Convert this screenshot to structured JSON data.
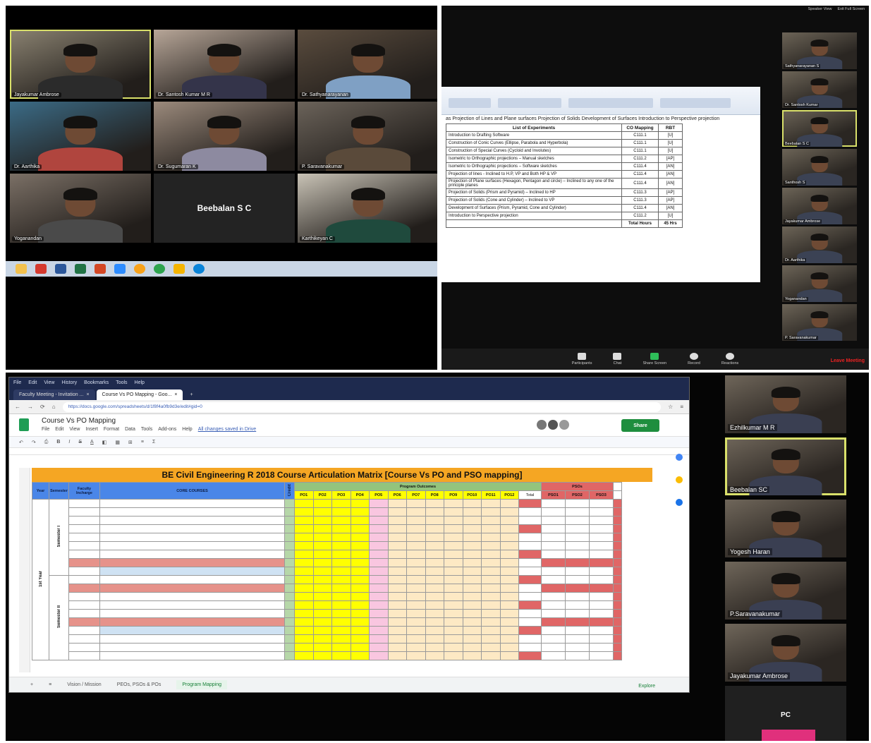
{
  "gallery": {
    "tiles": [
      {
        "name": "Jayakumar Ambrose",
        "shirt": "#2b2b2b",
        "bg": "#8a8271"
      },
      {
        "name": "Dr. Santosh Kumar M R",
        "shirt": "#34344a",
        "bg": "#b7a698"
      },
      {
        "name": "Dr. Sathyanarayanan",
        "shirt": "#7fa0c4",
        "bg": "#5a4c3e"
      },
      {
        "name": "Dr. Aarthika",
        "shirt": "#b0453e",
        "bg": "#3b6b86"
      },
      {
        "name": "Dr. Sugumaran K",
        "shirt": "#8d8aa0",
        "bg": "#9b8a7c"
      },
      {
        "name": "P. Saravanakumar",
        "shirt": "#5a4a3a",
        "bg": "#6b635a"
      },
      {
        "name": "Yoganandan",
        "shirt": "#4a4a4a",
        "bg": "#7b7066"
      },
      {
        "name": "Beebalan S C",
        "blank": true
      },
      {
        "name": "Karthikeyan C",
        "shirt": "#1f4a3d",
        "bg": "#c9c3b6"
      }
    ]
  },
  "word": {
    "heading_text": "as Projection of Lines and Plane surfaces Projection of Solids Development of Surfaces Introduction to Perspective projection",
    "headers": [
      "List of Experiments",
      "CO Mapping",
      "RBT"
    ],
    "rows": [
      [
        "Introduction to Drafting Software",
        "C111.1",
        "[U]"
      ],
      [
        "Construction of Conic Curves (Ellipse, Parabola and Hyperbola)",
        "C111.1",
        "[U]"
      ],
      [
        "Construction of Special Curves (Cycloid and Involutes)",
        "C111.1",
        "[U]"
      ],
      [
        "Isometric to Orthographic projections – Manual sketches",
        "C111.2",
        "[AP]"
      ],
      [
        "Isometric to Orthographic projections – Software sketches",
        "C111.4",
        "[AN]"
      ],
      [
        "Projection of lines - Inclined to H.P, VP and Both HP & VP",
        "C111.4",
        "[AN]"
      ],
      [
        "Projection of Plane surfaces (Hexagon, Pentagon and circle) – Inclined to any one of the principle planes",
        "C111.4",
        "[AN]"
      ],
      [
        "Projection of Solids (Prism and Pyramid) – Inclined to HP",
        "C111.3",
        "[AP]"
      ],
      [
        "Projection of Solids (Cone and Cylinder) – Inclined to VP",
        "C111.3",
        "[AP]"
      ],
      [
        "Development of Surfaces (Prism, Pyramid, Cone and Cylinder)",
        "C111.4",
        "[AN]"
      ],
      [
        "Introduction to Perspective projection",
        "C111.2",
        "[U]"
      ]
    ],
    "total_label": "Total Hours",
    "total_value": "45 Hrs"
  },
  "side_thumbs": [
    {
      "name": "Sathyanarayanan S",
      "active": false
    },
    {
      "name": "Dr. Santosh Kumar",
      "active": false
    },
    {
      "name": "Beebalan S C",
      "active": true
    },
    {
      "name": "Santhosh S",
      "active": false
    },
    {
      "name": "Jayakumar Ambrose",
      "active": false
    },
    {
      "name": "Dr. Aarthika",
      "active": false
    },
    {
      "name": "Yoganandan",
      "active": false
    },
    {
      "name": "P. Saravanakumar",
      "active": false
    }
  ],
  "zoom_bar": {
    "buttons": [
      "Participants",
      "Chat",
      "Share Screen",
      "Record",
      "Reactions"
    ],
    "leave": "Leave Meeting",
    "top_right": [
      "Speaker View",
      "Exit Full Screen"
    ]
  },
  "browser": {
    "menu": [
      "File",
      "Edit",
      "View",
      "History",
      "Bookmarks",
      "Tools",
      "Help"
    ],
    "tabs": [
      "Faculty Meeting - Invitation ...",
      "Course Vs PO Mapping - Goo..."
    ],
    "url": "https://docs.google.com/spreadsheets/d/1f8f4a0fb9d3e/edit#gid=0"
  },
  "sheet": {
    "doc_title": "Course Vs PO Mapping",
    "menu": [
      "File",
      "Edit",
      "View",
      "Insert",
      "Format",
      "Data",
      "Tools",
      "Add-ons",
      "Help"
    ],
    "saved": "All changes saved in Drive",
    "share": "Share",
    "title": "BE Civil Engineering R 2018 Course Articulation Matrix [Course Vs PO and PSO mapping]",
    "col_year": "Year",
    "col_sem": "Semester",
    "col_fac": "Faculty Incharge",
    "col_core": "CORE COURSES",
    "col_credit": "Credit",
    "group_po": "Program Outcomes",
    "group_pso": "PSOs",
    "po_headers": [
      "PO1",
      "PO2",
      "PO3",
      "PO4",
      "PO5",
      "PO6",
      "PO7",
      "PO8",
      "PO9",
      "PO10",
      "PO11",
      "PO12",
      "Total"
    ],
    "pso_headers": [
      "PSO1",
      "PSO2",
      "PSO3"
    ],
    "year_label": "1st Year",
    "sem1_label": "Semester I",
    "sem2_label": "Semester II",
    "tabs": [
      "Vision / Mission",
      "PEOs, PSOs & POs",
      "Program Mapping"
    ],
    "explore": "Explore"
  },
  "right_tiles": [
    {
      "name": "Ezhilkumar M R",
      "active": false
    },
    {
      "name": "Beebalan SC",
      "active": true
    },
    {
      "name": "Yogesh Haran",
      "active": false
    },
    {
      "name": "P.Saravanakumar",
      "active": false
    },
    {
      "name": "Jayakumar Ambrose",
      "active": false
    },
    {
      "name": "PC",
      "blank": true
    }
  ]
}
